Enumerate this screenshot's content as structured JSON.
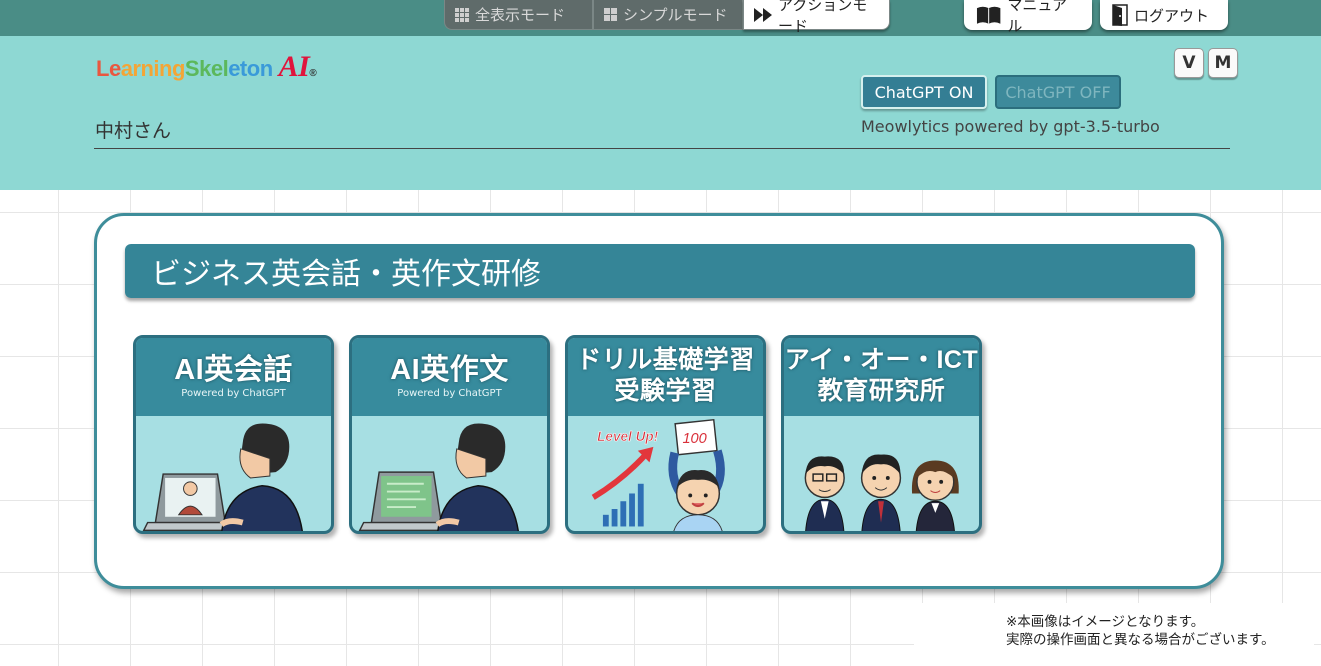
{
  "topbar": {
    "modes": [
      {
        "label": "全表示モード",
        "icon": "grid-nine-icon",
        "active": false
      },
      {
        "label": "シンプルモード",
        "icon": "grid-four-icon",
        "active": false
      },
      {
        "label": "アクションモード",
        "icon": "fast-forward-icon",
        "active": true
      }
    ],
    "manual_label": "マニュアル",
    "logout_label": "ログアウト"
  },
  "header": {
    "logo_text": [
      "Le",
      "arning ",
      "Skel",
      "eton"
    ],
    "logo_ai": "AI",
    "logo_reg": "®",
    "username": "中村さん",
    "chatgpt_on": "ChatGPT ON",
    "chatgpt_off": "ChatGPT OFF",
    "powered_by": "Meowlytics powered by gpt-3.5-turbo",
    "v_button": "V",
    "m_button": "M"
  },
  "panel": {
    "title": "ビジネス英会話・英作文研修",
    "tiles": [
      {
        "title": "AI英会話",
        "subtitle": "Powered by ChatGPT"
      },
      {
        "title": "AI英作文",
        "subtitle": "Powered by ChatGPT"
      },
      {
        "title_line1": "ドリル基礎学習",
        "title_line2": "受験学習",
        "art_label": "Level Up!",
        "art_score": "100"
      },
      {
        "title_line1": "アイ・オー・ICT",
        "title_line2": "教育研究所"
      }
    ]
  },
  "notice": {
    "line1": "※本画像はイメージとなります。",
    "line2": "実際の操作画面と異なる場合がございます。"
  },
  "colors": {
    "topbar": "#4a8d86",
    "header": "#8ed8d3",
    "panel_border": "#3e8d9a",
    "title_bar": "#358597",
    "tile_head": "#378b9d",
    "tile_body": "#a7dfe3"
  }
}
